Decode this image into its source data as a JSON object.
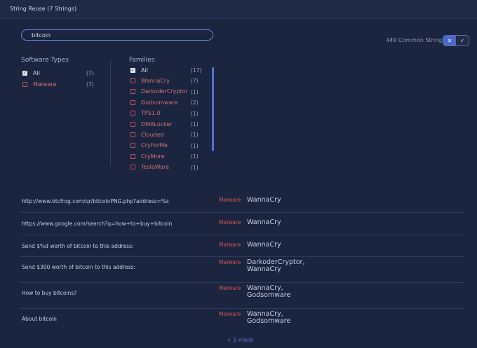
{
  "header": {
    "title": "String Reuse (7 Strings)"
  },
  "search": {
    "value": "bitcoin"
  },
  "common": {
    "label": "449 Common Strings",
    "toggle_x": "✕",
    "toggle_check": "✓"
  },
  "software_types": {
    "title": "Software Types",
    "items": [
      {
        "label": "All",
        "count": "(7)",
        "checked": true
      },
      {
        "label": "Malware",
        "count": "(7)",
        "checked": false
      }
    ]
  },
  "families": {
    "title": "Families",
    "items": [
      {
        "label": "All",
        "count": "(17)",
        "checked": true
      },
      {
        "label": "WannaCry",
        "count": "(7)",
        "checked": false
      },
      {
        "label": "DarkoderCryptor",
        "count": "(1)",
        "checked": false
      },
      {
        "label": "Godsomware",
        "count": "(2)",
        "checked": false
      },
      {
        "label": "TPS1.0",
        "count": "(1)",
        "checked": false
      },
      {
        "label": "DMALocker",
        "count": "(1)",
        "checked": false
      },
      {
        "label": "Clouded",
        "count": "(1)",
        "checked": false
      },
      {
        "label": "CryForMe",
        "count": "(1)",
        "checked": false
      },
      {
        "label": "CryMore",
        "count": "(1)",
        "checked": false
      },
      {
        "label": "TeslaWare",
        "count": "(1)",
        "checked": false
      }
    ]
  },
  "rows": [
    {
      "string": "http://www.btcfrog.com/qr/bitcoinPNG.php?address=%s",
      "type": "Malware",
      "family": "WannaCry"
    },
    {
      "string": "https://www.google.com/search?q=how+to+buy+bitcoin",
      "type": "Malware",
      "family": "WannaCry"
    },
    {
      "string": "Send $%d worth of bitcoin to this address:",
      "type": "Malware",
      "family": "WannaCry"
    },
    {
      "string": "Send $300 worth of bitcoin to this address:",
      "type": "Malware",
      "family": "DarkoderCryptor,\nWannaCry"
    },
    {
      "string": "How to buy bitcoins?",
      "type": "Malware",
      "family": "WannaCry,\nGodsomware"
    },
    {
      "string": "About bitcoin",
      "type": "Malware",
      "family": "WannaCry,\nGodsomware"
    }
  ],
  "more": {
    "label": "+ 1 more"
  }
}
